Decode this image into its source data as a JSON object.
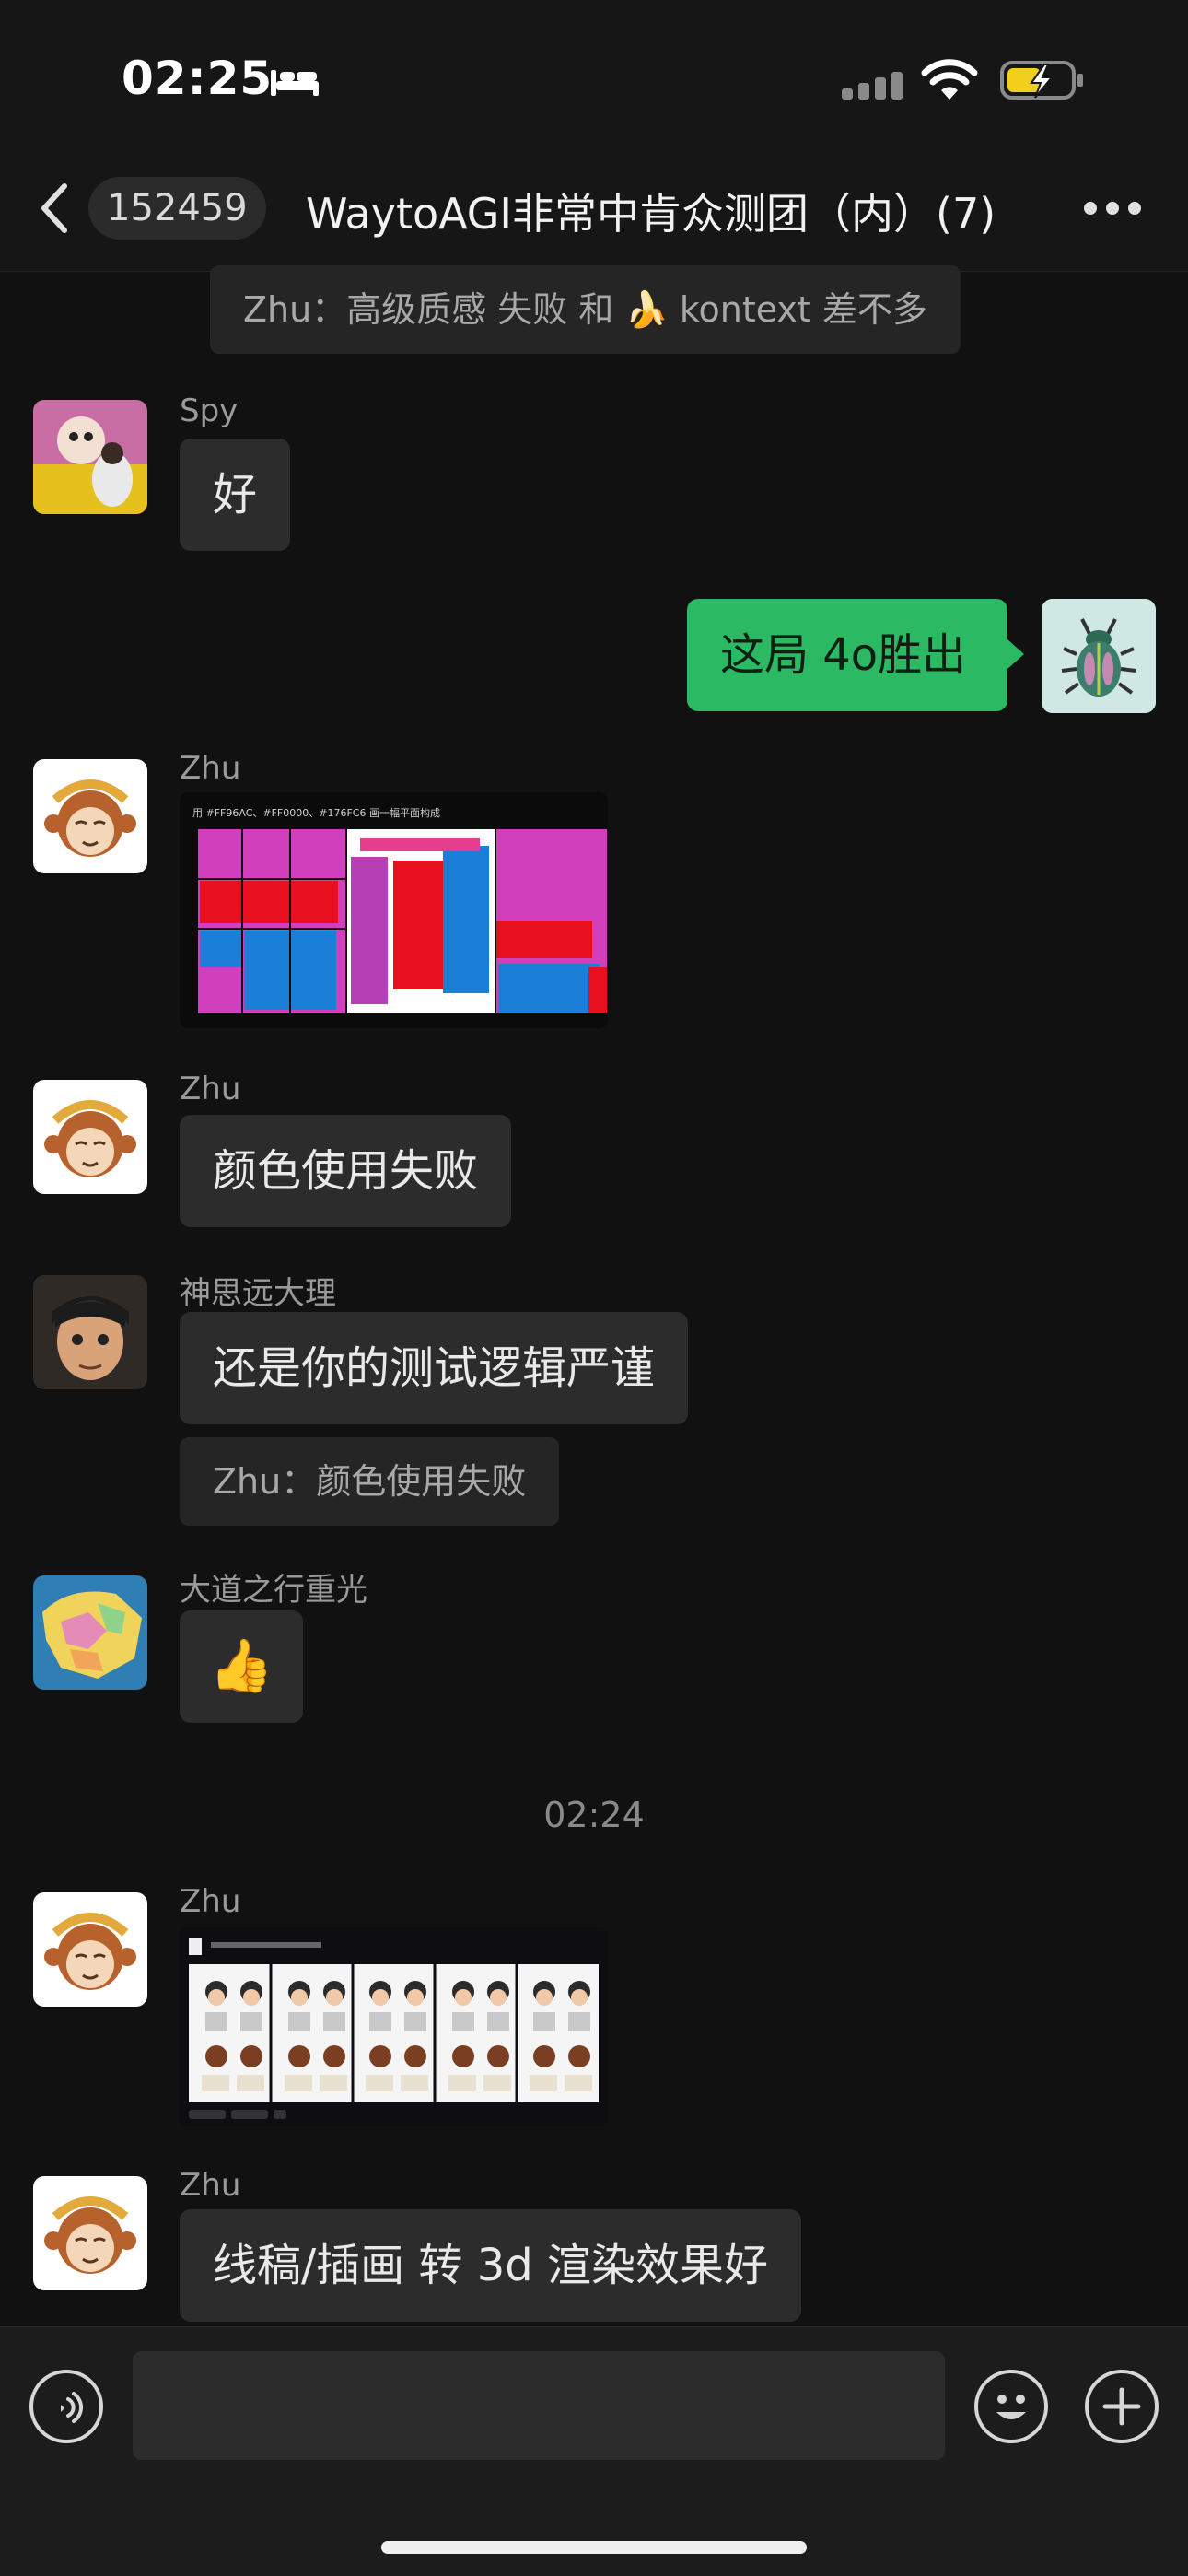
{
  "status_bar": {
    "time": "02:25"
  },
  "header": {
    "unread_count": "152459",
    "title": "WaytoAGI非常中肯众测团（内）(7)"
  },
  "messages": {
    "quote_top": "Zhu：高级质感 失败 和 🍌 kontext 差不多",
    "m1": {
      "sender": "Spy",
      "text": "好"
    },
    "m2": {
      "text": "这局 4o胜出"
    },
    "m3": {
      "sender": "Zhu",
      "image_caption": "用 #FF96AC、#FF0000、#176FC6 画一幅平面构成"
    },
    "m4": {
      "sender": "Zhu",
      "text": "颜色使用失败"
    },
    "m5": {
      "sender": "神思远大理",
      "text": "还是你的测试逻辑严谨",
      "quote": "Zhu：颜色使用失败"
    },
    "m6": {
      "sender": "大道之行重光",
      "text": "👍"
    },
    "timestamp": "02:24",
    "m7": {
      "sender": "Zhu"
    },
    "m8": {
      "sender": "Zhu",
      "text": "线稿/插画 转 3d 渲染效果好"
    }
  },
  "colors": {
    "accent_green": "#2bba63",
    "background": "#111111",
    "bubble": "#2c2c2c"
  },
  "icons": [
    "bed-icon",
    "signal-icon",
    "wifi-icon",
    "battery-charging-icon",
    "back-chevron-icon",
    "more-dots-icon",
    "voice-icon",
    "emoji-icon",
    "add-icon"
  ]
}
